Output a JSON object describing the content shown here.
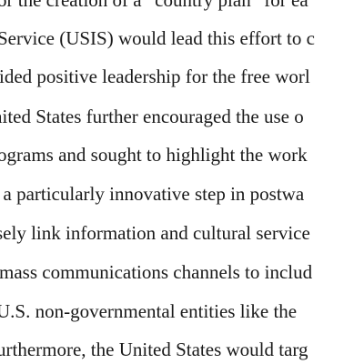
{
  "document": {
    "lines": [
      "or the creation of a “country plan” for ea",
      "Service (USIS) would lead this effort to c",
      "ided positive leadership for the free worl",
      "nited States further encouraged the use o",
      "ograms and sought to highlight the work",
      ", a particularly innovative step in postwa",
      "sely link information and cultural service",
      "mass communications channels to includ",
      "U.S. non-governmental entities like the",
      "urthermore, the United States would targ"
    ]
  }
}
